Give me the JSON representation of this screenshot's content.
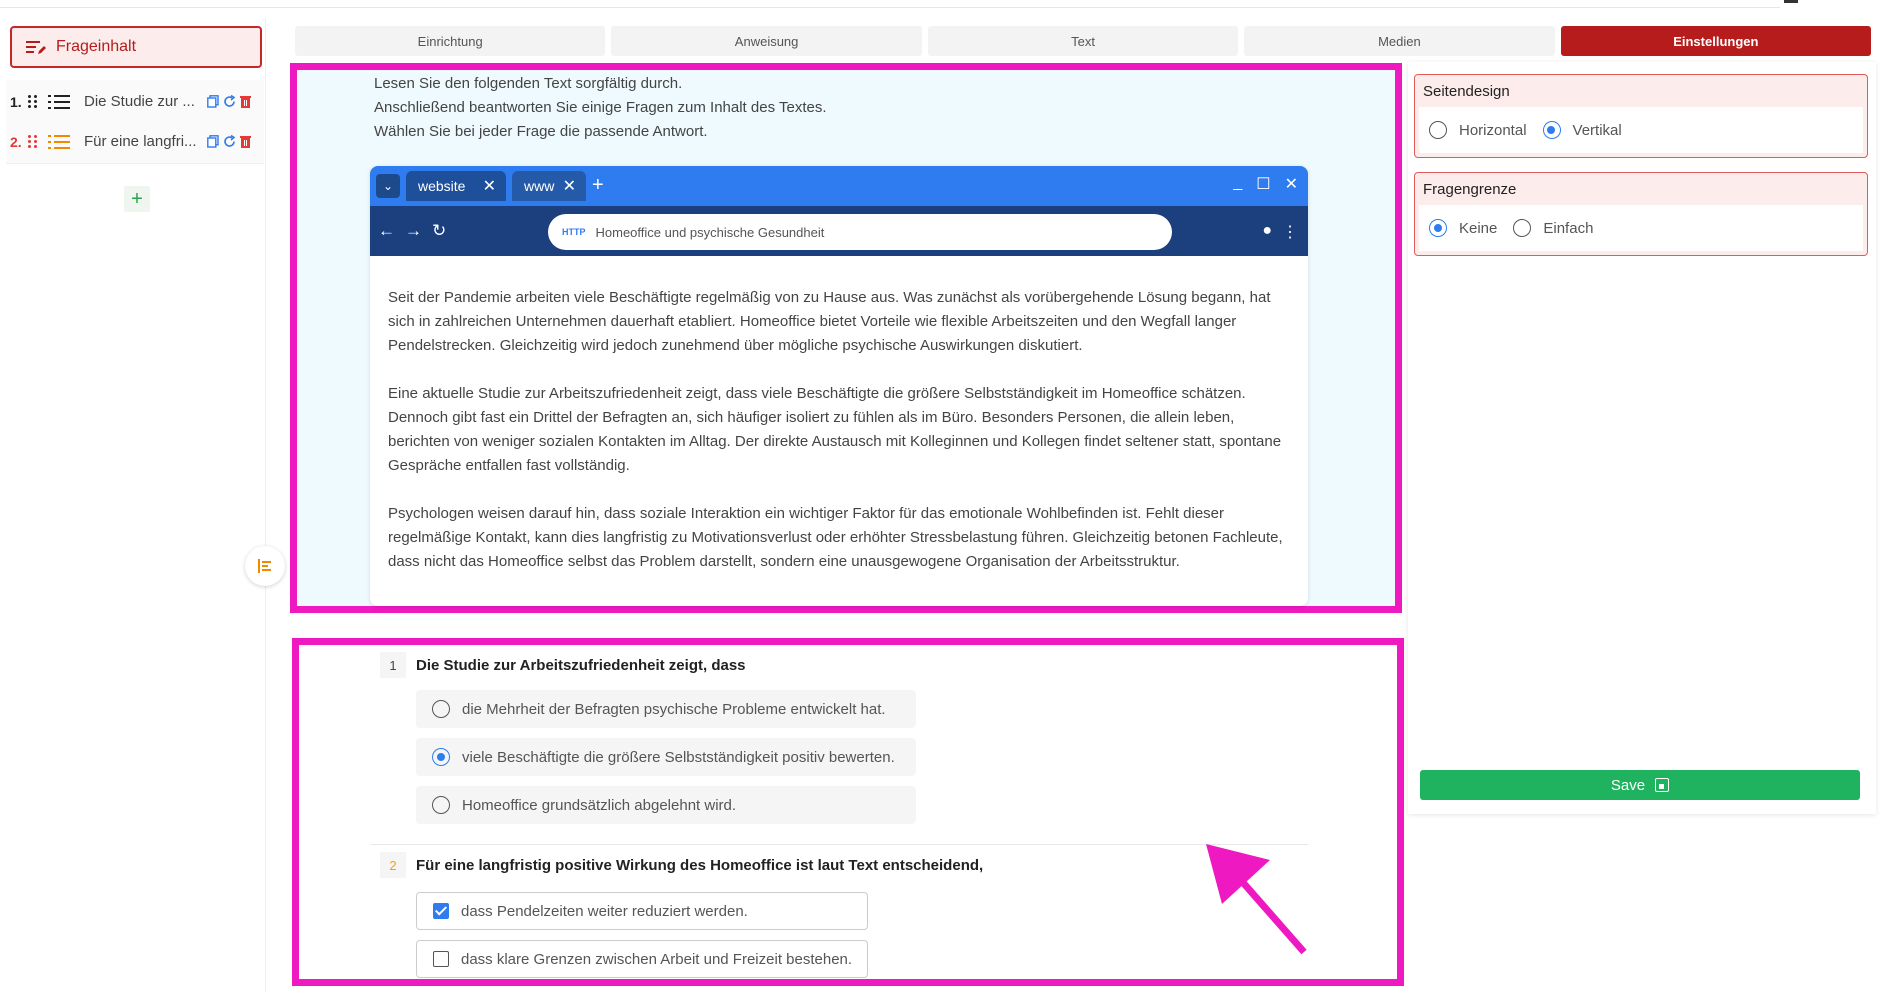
{
  "sidebar": {
    "main_button": "Frageinhalt",
    "items": [
      {
        "num": "1.",
        "label": "Die Studie zur ...",
        "num_color": "#222222"
      },
      {
        "num": "2.",
        "label": "Für eine langfri...",
        "num_color": "#e53935"
      }
    ],
    "add_label": "+"
  },
  "tabs": [
    "Einrichtung",
    "Anweisung",
    "Text",
    "Medien",
    "Einstellungen"
  ],
  "active_tab": "Einstellungen",
  "instructions": [
    "Lesen Sie den folgenden Text sorgfältig durch.",
    "Anschließend beantworten Sie einige Fragen zum Inhalt des Textes.",
    "Wählen Sie bei jeder Frage die passende Antwort."
  ],
  "browser": {
    "tabs": [
      "website",
      "www"
    ],
    "url_prefix": "HTTP",
    "url": "Homeoffice und psychische Gesundheit",
    "paragraphs": [
      "Seit der Pandemie arbeiten viele Beschäftigte regelmäßig von zu Hause aus. Was zunächst als vorübergehende Lösung begann, hat sich in zahlreichen Unternehmen dauerhaft etabliert. Homeoffice bietet Vorteile wie flexible Arbeitszeiten und den Wegfall langer Pendelstrecken. Gleichzeitig wird jedoch zunehmend über mögliche psychische Auswirkungen diskutiert.",
      "Eine aktuelle Studie zur Arbeitszufriedenheit zeigt, dass viele Beschäftigte die größere Selbstständigkeit im Homeoffice schätzen. Dennoch gibt fast ein Drittel der Befragten an, sich häufiger isoliert zu fühlen als im Büro. Besonders Personen, die allein leben, berichten von weniger sozialen Kontakten im Alltag. Der direkte Austausch mit Kolleginnen und Kollegen findet seltener statt, spontane Gespräche entfallen fast vollständig.",
      "Psychologen weisen darauf hin, dass soziale Interaktion ein wichtiger Faktor für das emotionale Wohlbefinden ist. Fehlt dieser regelmäßige Kontakt, kann dies langfristig zu Motivationsverlust oder erhöhter Stressbelastung führen. Gleichzeitig betonen Fachleute, dass nicht das Homeoffice selbst das Problem darstellt, sondern eine unausgewogene Organisation der Arbeitsstruktur."
    ]
  },
  "questions": [
    {
      "num": "1",
      "text": "Die Studie zur Arbeitszufriedenheit zeigt, dass",
      "options": [
        {
          "text": "die Mehrheit der Befragten psychische Probleme entwickelt hat.",
          "selected": false
        },
        {
          "text": "viele Beschäftigte die größere Selbstständigkeit positiv bewerten.",
          "selected": true
        },
        {
          "text": "Homeoffice grundsätzlich abgelehnt wird.",
          "selected": false
        }
      ]
    },
    {
      "num": "2",
      "text": "Für eine langfristig positive Wirkung des Homeoffice ist laut Text entscheidend,",
      "options": [
        {
          "text": "dass Pendelzeiten weiter reduziert werden.",
          "checked": true
        },
        {
          "text": "dass klare Grenzen zwischen Arbeit und Freizeit bestehen.",
          "checked": false
        }
      ]
    }
  ],
  "settings": {
    "seitendesign": {
      "title": "Seitendesign",
      "options": [
        "Horizontal",
        "Vertikal"
      ],
      "selected": "Vertikal"
    },
    "fragengrenze": {
      "title": "Fragengrenze",
      "options": [
        "Keine",
        "Einfach"
      ],
      "selected": "Keine"
    },
    "save_label": "Save"
  },
  "colors": {
    "accent": "#b71c1c",
    "highlight": "#ee19c0",
    "save": "#1fb35f",
    "blue": "#2f7cf0"
  },
  "icons": [
    "edit-list-icon",
    "drag-icon",
    "list-icon",
    "copy-icon",
    "refresh-icon",
    "trash-icon",
    "plus-icon",
    "align-icon",
    "disk-icon"
  ]
}
